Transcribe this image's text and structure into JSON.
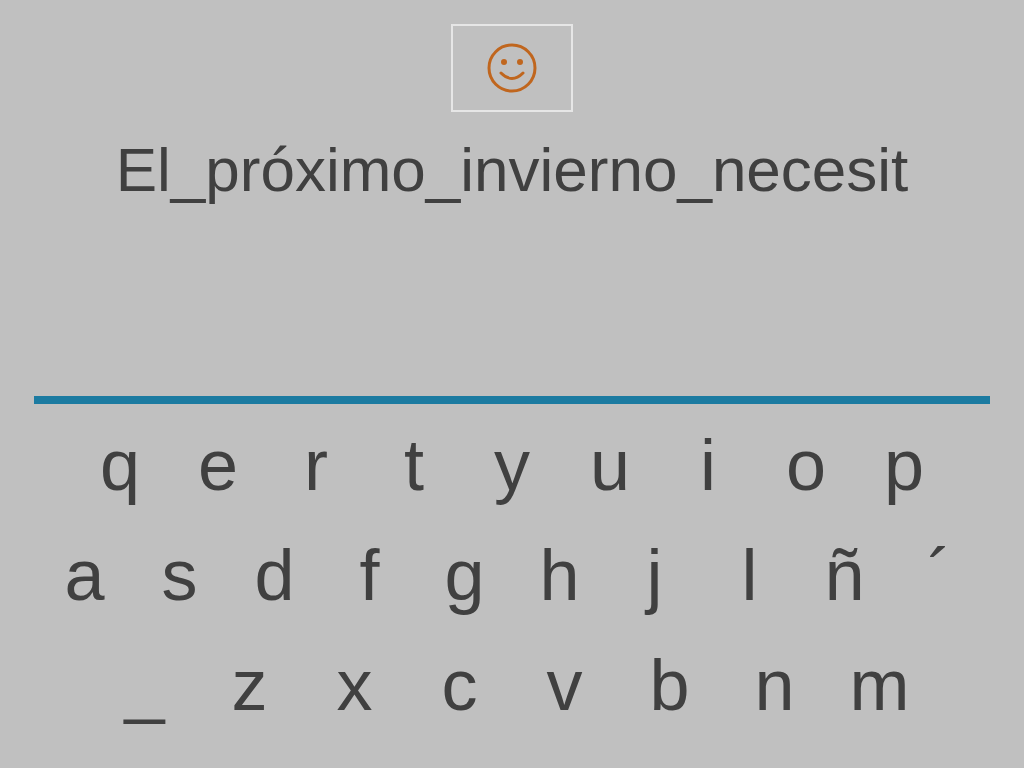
{
  "answer": {
    "text": "El_próximo_invierno_necesit"
  },
  "keyboard": {
    "rows": [
      [
        "q",
        "e",
        "r",
        "t",
        "y",
        "u",
        "i",
        "o",
        "p"
      ],
      [
        "a",
        "s",
        "d",
        "f",
        "g",
        "h",
        "j",
        "l",
        "ñ",
        "´"
      ],
      [
        "_",
        "z",
        "x",
        "c",
        "v",
        "b",
        "n",
        "m"
      ]
    ]
  }
}
